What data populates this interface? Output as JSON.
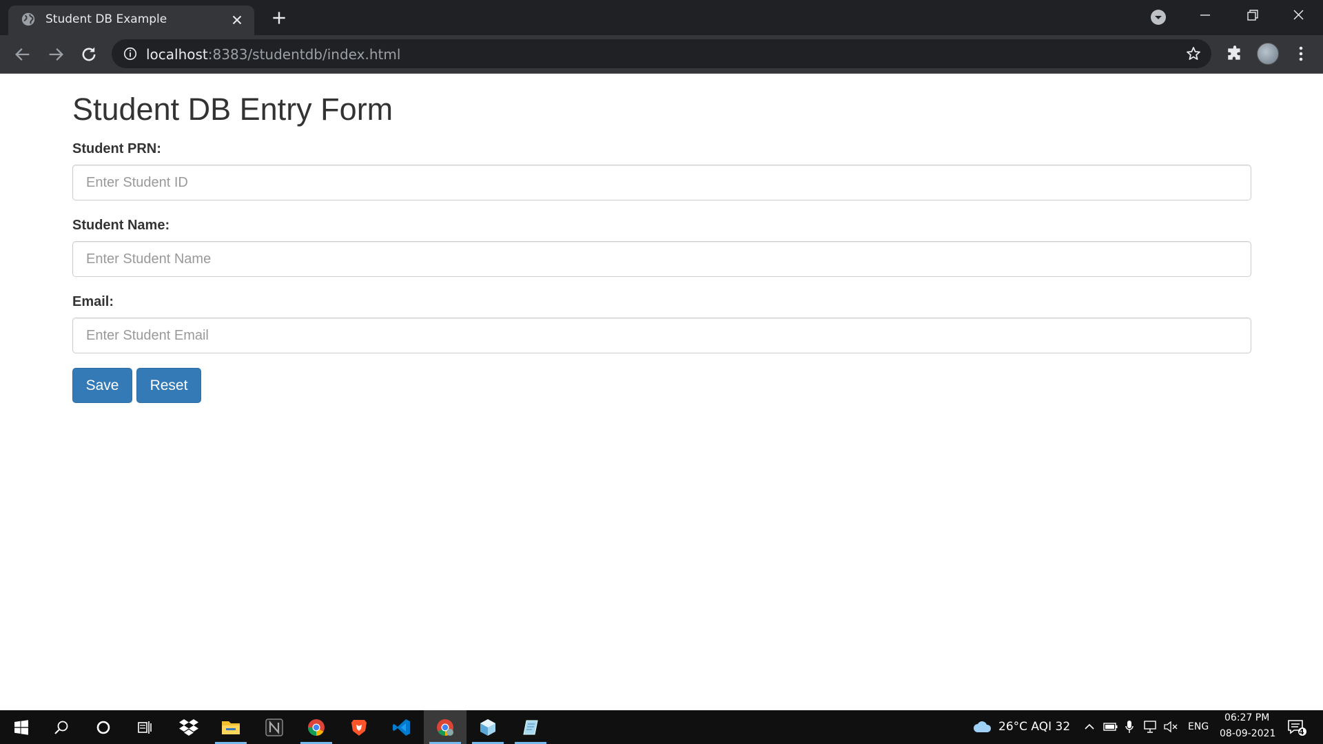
{
  "browser": {
    "tab_title": "Student DB Example",
    "url_host": "localhost",
    "url_rest": ":8383/studentdb/index.html"
  },
  "form": {
    "heading": "Student DB Entry Form",
    "prn_label": "Student PRN:",
    "prn_placeholder": "Enter Student ID",
    "prn_value": "",
    "name_label": "Student Name:",
    "name_placeholder": "Enter Student Name",
    "name_value": "",
    "email_label": "Email:",
    "email_placeholder": "Enter Student Email",
    "email_value": "",
    "save_label": "Save",
    "reset_label": "Reset"
  },
  "colors": {
    "primary_button": "#337ab7",
    "browser_frame": "#202124",
    "taskbar": "#101010"
  },
  "taskbar": {
    "apps": [
      "windows-start-icon",
      "search-icon",
      "cortana-icon",
      "task-view-icon",
      "dropbox-icon",
      "file-explorer-icon",
      "notion-icon",
      "chrome-icon",
      "brave-icon",
      "vscode-icon",
      "chrome-active-icon",
      "netbeans-icon",
      "notes-icon"
    ],
    "weather": "26°C  AQI 32",
    "language": "ENG",
    "time": "06:27 PM",
    "date": "08-09-2021",
    "notification_count": "4"
  }
}
